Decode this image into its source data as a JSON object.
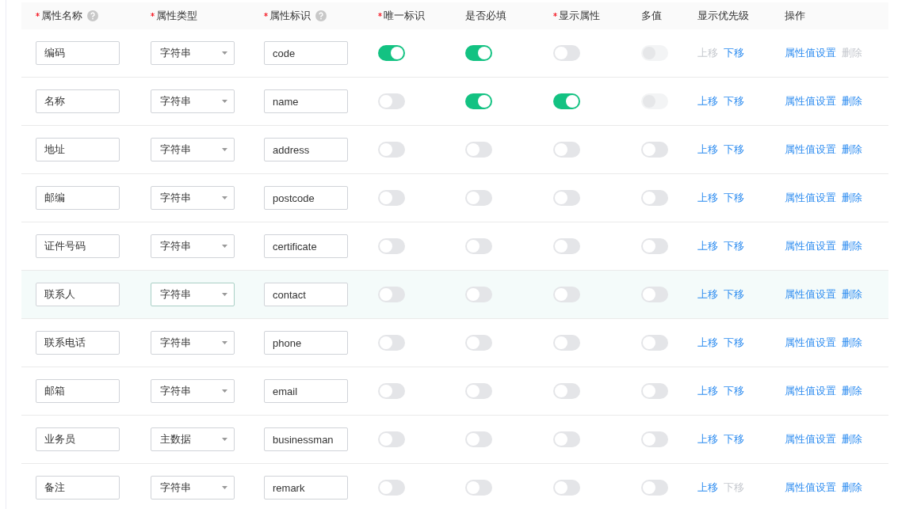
{
  "columns": [
    {
      "label": "属性名称",
      "required": true,
      "help": true
    },
    {
      "label": "属性类型",
      "required": true,
      "help": false
    },
    {
      "label": "属性标识",
      "required": true,
      "help": true
    },
    {
      "label": "唯一标识",
      "required": true,
      "help": false
    },
    {
      "label": "是否必填",
      "required": false,
      "help": false
    },
    {
      "label": "显示属性",
      "required": true,
      "help": false
    },
    {
      "label": "多值",
      "required": false,
      "help": false
    },
    {
      "label": "显示优先级",
      "required": false,
      "help": false
    },
    {
      "label": "操作",
      "required": false,
      "help": false
    }
  ],
  "rows": [
    {
      "name": "编码",
      "type": "字符串",
      "key": "code",
      "unique": true,
      "mandatory": true,
      "display": false,
      "multi": false,
      "multi_disabled": true,
      "up": {
        "label": "上移",
        "disabled": true
      },
      "down": {
        "label": "下移",
        "disabled": false
      },
      "settings": "属性值设置",
      "delete": {
        "label": "删除",
        "disabled": true
      },
      "hovered": false
    },
    {
      "name": "名称",
      "type": "字符串",
      "key": "name",
      "unique": false,
      "mandatory": true,
      "display": true,
      "multi": false,
      "multi_disabled": true,
      "up": {
        "label": "上移",
        "disabled": false
      },
      "down": {
        "label": "下移",
        "disabled": false
      },
      "settings": "属性值设置",
      "delete": {
        "label": "删除",
        "disabled": false
      },
      "hovered": false
    },
    {
      "name": "地址",
      "type": "字符串",
      "key": "address",
      "unique": false,
      "mandatory": false,
      "display": false,
      "multi": false,
      "multi_disabled": false,
      "up": {
        "label": "上移",
        "disabled": false
      },
      "down": {
        "label": "下移",
        "disabled": false
      },
      "settings": "属性值设置",
      "delete": {
        "label": "删除",
        "disabled": false
      },
      "hovered": false
    },
    {
      "name": "邮编",
      "type": "字符串",
      "key": "postcode",
      "unique": false,
      "mandatory": false,
      "display": false,
      "multi": false,
      "multi_disabled": false,
      "up": {
        "label": "上移",
        "disabled": false
      },
      "down": {
        "label": "下移",
        "disabled": false
      },
      "settings": "属性值设置",
      "delete": {
        "label": "删除",
        "disabled": false
      },
      "hovered": false
    },
    {
      "name": "证件号码",
      "type": "字符串",
      "key": "certificate",
      "unique": false,
      "mandatory": false,
      "display": false,
      "multi": false,
      "multi_disabled": false,
      "up": {
        "label": "上移",
        "disabled": false
      },
      "down": {
        "label": "下移",
        "disabled": false
      },
      "settings": "属性值设置",
      "delete": {
        "label": "删除",
        "disabled": false
      },
      "hovered": false
    },
    {
      "name": "联系人",
      "type": "字符串",
      "key": "contact",
      "unique": false,
      "mandatory": false,
      "display": false,
      "multi": false,
      "multi_disabled": false,
      "up": {
        "label": "上移",
        "disabled": false
      },
      "down": {
        "label": "下移",
        "disabled": false
      },
      "settings": "属性值设置",
      "delete": {
        "label": "删除",
        "disabled": false
      },
      "hovered": true
    },
    {
      "name": "联系电话",
      "type": "字符串",
      "key": "phone",
      "unique": false,
      "mandatory": false,
      "display": false,
      "multi": false,
      "multi_disabled": false,
      "up": {
        "label": "上移",
        "disabled": false
      },
      "down": {
        "label": "下移",
        "disabled": false
      },
      "settings": "属性值设置",
      "delete": {
        "label": "删除",
        "disabled": false
      },
      "hovered": false
    },
    {
      "name": "邮箱",
      "type": "字符串",
      "key": "email",
      "unique": false,
      "mandatory": false,
      "display": false,
      "multi": false,
      "multi_disabled": false,
      "up": {
        "label": "上移",
        "disabled": false
      },
      "down": {
        "label": "下移",
        "disabled": false
      },
      "settings": "属性值设置",
      "delete": {
        "label": "删除",
        "disabled": false
      },
      "hovered": false
    },
    {
      "name": "业务员",
      "type": "主数据",
      "key": "businessman",
      "unique": false,
      "mandatory": false,
      "display": false,
      "multi": false,
      "multi_disabled": false,
      "up": {
        "label": "上移",
        "disabled": false
      },
      "down": {
        "label": "下移",
        "disabled": false
      },
      "settings": "属性值设置",
      "delete": {
        "label": "删除",
        "disabled": false
      },
      "hovered": false
    },
    {
      "name": "备注",
      "type": "字符串",
      "key": "remark",
      "unique": false,
      "mandatory": false,
      "display": false,
      "multi": false,
      "multi_disabled": false,
      "up": {
        "label": "上移",
        "disabled": false
      },
      "down": {
        "label": "下移",
        "disabled": true
      },
      "settings": "属性值设置",
      "delete": {
        "label": "删除",
        "disabled": false
      },
      "hovered": false
    }
  ]
}
